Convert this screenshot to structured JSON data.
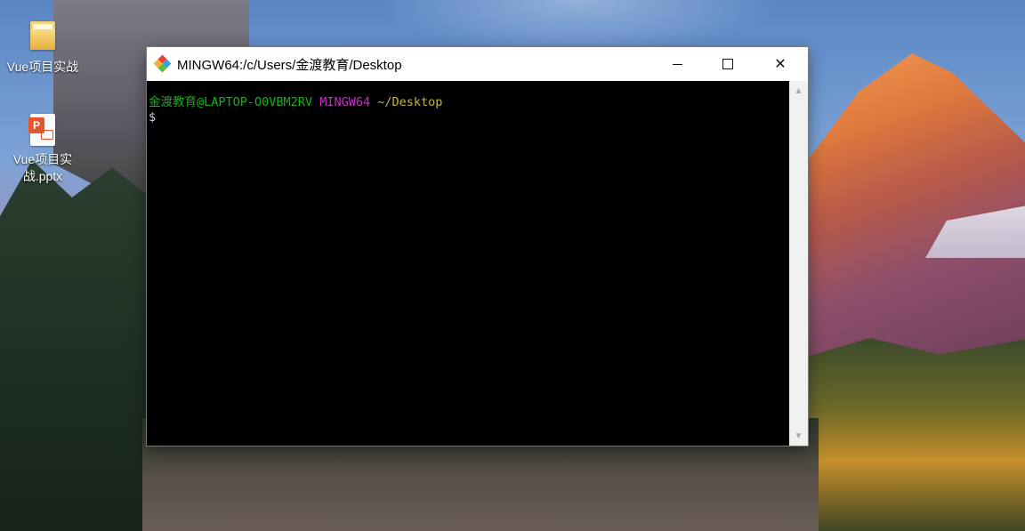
{
  "desktop": {
    "icons": [
      {
        "label": "Vue项目实战",
        "type": "folder-icon"
      },
      {
        "label": "Vue项目实战.pptx",
        "label_line1": "Vue项目实",
        "label_line2": "战.pptx",
        "type": "powerpoint-file-icon"
      }
    ]
  },
  "window": {
    "title": "MINGW64:/c/Users/金渡教育/Desktop",
    "app_icon": "git-diamond-icon",
    "controls": {
      "minimize": "minimize-icon",
      "maximize": "maximize-icon",
      "close": "close-icon"
    }
  },
  "terminal": {
    "user_host": "金渡教育@LAPTOP-O0VBM2RV",
    "system": "MINGW64",
    "path": "~/Desktop",
    "prompt": "$",
    "colors": {
      "user": "#12b312",
      "system": "#c930c9",
      "path": "#c8b53a",
      "background": "#000000"
    }
  },
  "icons": {
    "ppt_badge": "P",
    "scroll_up": "▲",
    "scroll_down": "▼",
    "close_glyph": "✕"
  }
}
